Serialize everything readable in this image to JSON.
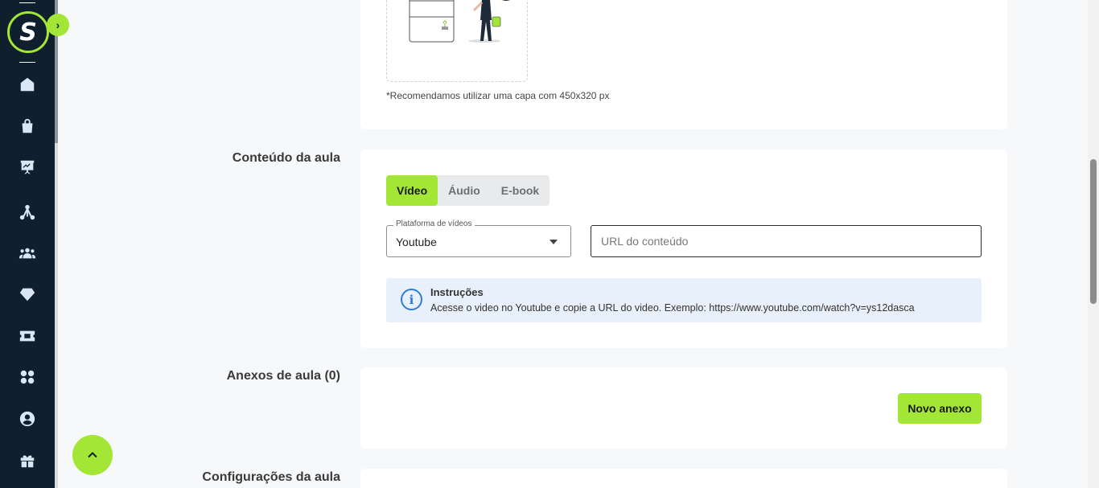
{
  "sidebar": {
    "logo_letter": "S",
    "expand_icon": "chevron-right-icon",
    "items": [
      {
        "icon": "home-icon"
      },
      {
        "icon": "shopping-bag-icon"
      },
      {
        "icon": "presentation-chart-icon"
      },
      {
        "icon": "network-icon"
      },
      {
        "icon": "users-icon"
      },
      {
        "icon": "diamond-icon"
      },
      {
        "icon": "ticket-icon"
      },
      {
        "icon": "apps-grid-icon"
      },
      {
        "icon": "user-circle-icon"
      },
      {
        "icon": "gift-icon"
      }
    ]
  },
  "cover": {
    "hint": "*Recomendamos utilizar uma capa com 450x320 px"
  },
  "content": {
    "section_label": "Conteúdo da aula",
    "tabs": [
      {
        "label": "Vídeo",
        "active": true
      },
      {
        "label": "Áudio",
        "active": false
      },
      {
        "label": "E-book",
        "active": false
      }
    ],
    "platform": {
      "legend": "Plataforma de vídeos",
      "value": "Youtube"
    },
    "url_placeholder": "URL do conteúdo",
    "instructions": {
      "title": "Instruções",
      "text": "Acesse o video no Youtube e copie a URL do video. Exemplo: https://www.youtube.com/watch?v=ys12dasca"
    }
  },
  "attachments": {
    "section_label": "Anexos de aula (0)",
    "new_button": "Novo anexo"
  },
  "settings": {
    "section_label": "Configurações da aula"
  },
  "colors": {
    "accent": "#a3e635",
    "sidebar_bg": "#0f1f2e",
    "info_bg": "#e8f0fb",
    "info_icon": "#2f7bd6"
  }
}
